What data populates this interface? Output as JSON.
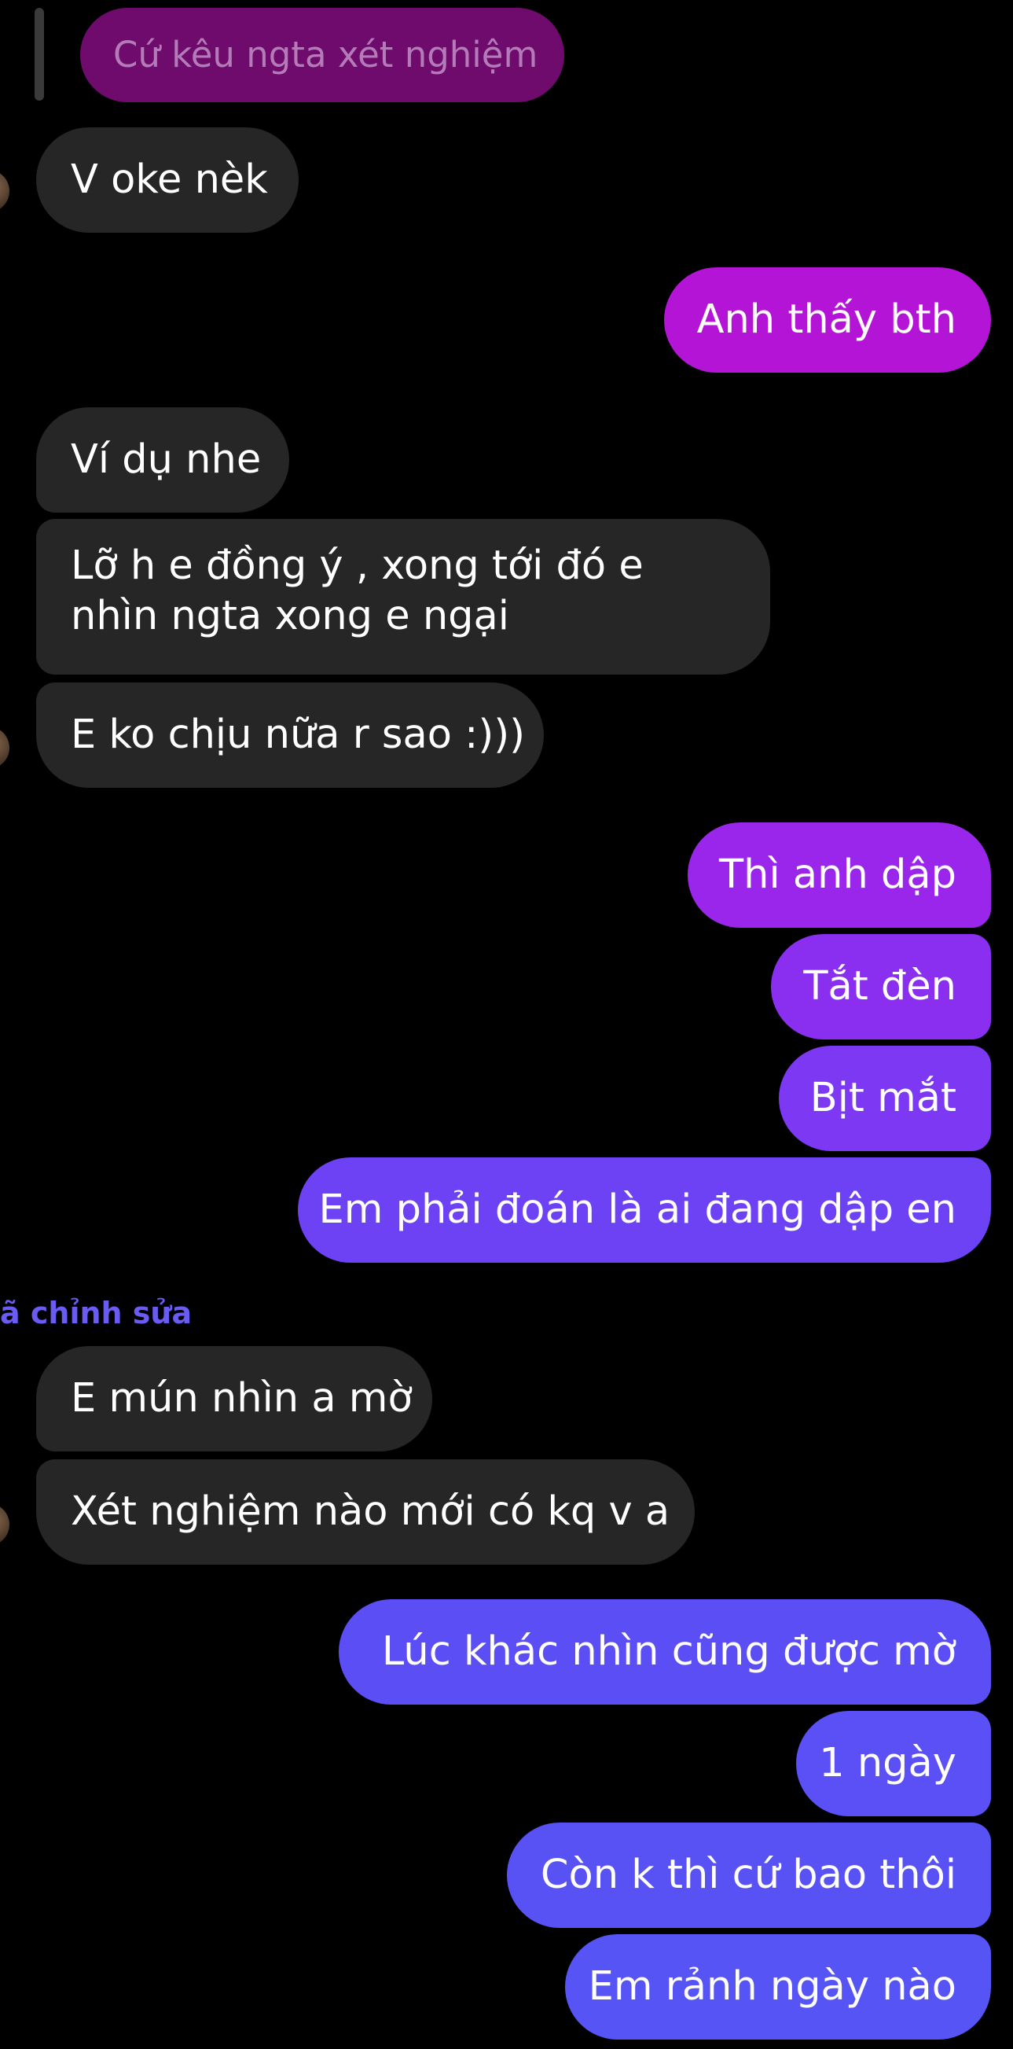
{
  "quoted_reply": "Cứ kêu ngta xét nghiệm",
  "edited_label": "ã chỉnh sửa",
  "messages": [
    {
      "text": "V oke nèk"
    },
    {
      "text": "Anh thấy bth",
      "color": "#b414d6"
    },
    {
      "text": "Ví dụ nhe"
    },
    {
      "text": "Lỡ h e đồng ý , xong tới đó e nhìn ngta xong e ngại"
    },
    {
      "text": "E ko chịu nữa r sao :)))"
    },
    {
      "text": "Thì anh dập",
      "color": "#9a26ec"
    },
    {
      "text": "Tắt đèn",
      "color": "#8a2ff0"
    },
    {
      "text": "Bịt mắt",
      "color": "#7c38f2"
    },
    {
      "text": "Em phải đoán là ai đang dập en",
      "color": "#6d42f4"
    },
    {
      "text": "E mún nhìn a mờ"
    },
    {
      "text": "Xét nghiệm nào mới có kq v a"
    },
    {
      "text": "Lúc khác nhìn cũng được mờ",
      "color": "#5c4ef5"
    },
    {
      "text": "1 ngày",
      "color": "#5a50f5"
    },
    {
      "text": "Còn k thì cứ bao thôi",
      "color": "#5852f5"
    },
    {
      "text": "Em rảnh ngày nào",
      "color": "#5754f5"
    }
  ]
}
